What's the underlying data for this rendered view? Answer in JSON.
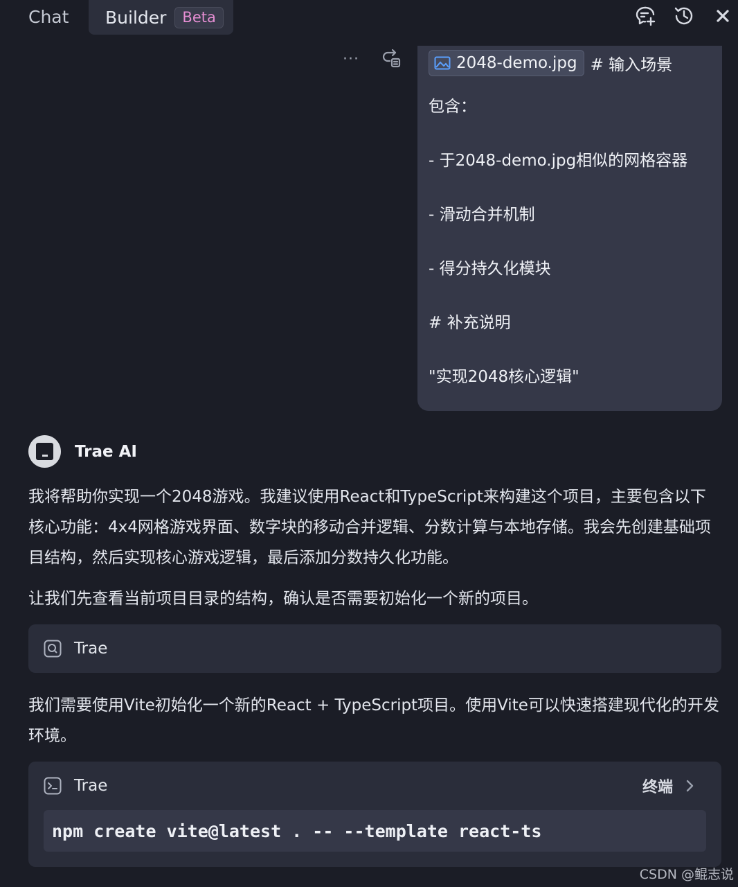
{
  "tabs": {
    "chat": "Chat",
    "builder": "Builder",
    "beta_badge": "Beta"
  },
  "toolbar_icons": [
    "new-chat-icon",
    "history-icon",
    "close-icon"
  ],
  "user_message": {
    "tool_icons": [
      "more-icon",
      "retry-icon"
    ],
    "more_label": "···",
    "attachment": {
      "name": "2048-demo.jpg",
      "icon": "image-icon"
    },
    "attachment_suffix": "# 输入场景",
    "lines": [
      "包含：",
      "- 于2048-demo.jpg相似的网格容器",
      "- 滑动合并机制",
      "- 得分持久化模块",
      "# 补充说明",
      "\"实现2048核心逻辑\""
    ]
  },
  "assistant": {
    "name": "Trae AI",
    "para1": "我将帮助你实现一个2048游戏。我建议使用React和TypeScript来构建这个项目，主要包含以下核心功能：4x4网格游戏界面、数字块的移动合并逻辑、分数计算与本地存储。我会先创建基础项目结构，然后实现核心游戏逻辑，最后添加分数持久化功能。",
    "para2": "让我们先查看当前项目目录的结构，确认是否需要初始化一个新的项目。",
    "search_card": {
      "icon": "search-icon",
      "label": "Trae"
    },
    "para3": "我们需要使用Vite初始化一个新的React + TypeScript项目。使用Vite可以快速搭建现代化的开发环境。",
    "terminal_card": {
      "icon": "terminal-icon",
      "label": "Trae",
      "action_label": "终端",
      "command": "npm create vite@latest . -- --template react-ts"
    }
  },
  "watermark": "CSDN @鲲志说"
}
